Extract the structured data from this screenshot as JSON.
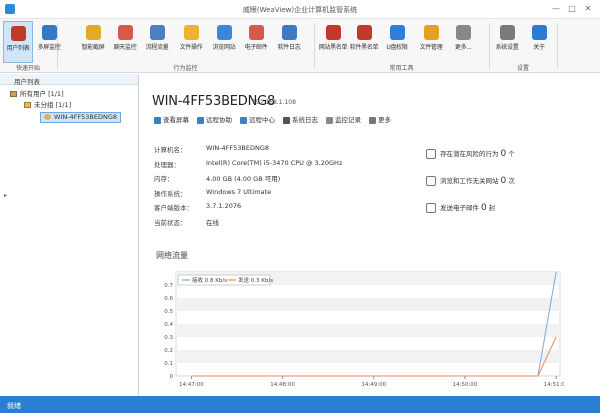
{
  "window": {
    "title": "威眼(WeaView)企业计算机监管系统",
    "min": "—",
    "max": "□",
    "close": "✕"
  },
  "ribbon": {
    "groups": [
      "快速开始",
      "行为监控",
      "常用工具",
      "设置"
    ],
    "buttons": [
      "用户列表",
      "多屏监控",
      "智能截屏",
      "聊天监控",
      "流程流量",
      "文件操作",
      "浏览网站",
      "电子邮件",
      "软件日志",
      "网站黑名单",
      "软件黑名单",
      "U盘权限",
      "文件管理",
      "更多...",
      "系统设置",
      "关于"
    ],
    "colors": [
      "#c0392b",
      "#3478c6",
      "#e0a92a",
      "#d65a4a",
      "#4a7fc1",
      "#f0b233",
      "#3a88d8",
      "#d55a4e",
      "#3e7bc4",
      "#c0392b",
      "#c0392b",
      "#2e7fd5",
      "#e8a024",
      "#888888",
      "#7a7a7a",
      "#2d7bd1"
    ]
  },
  "sidebar": {
    "header": "用户列表",
    "tree": [
      {
        "label": "所有用户 [1/1]"
      },
      {
        "label": "未分组 [1/1]"
      },
      {
        "label": "WIN-4FF53BEDNG8"
      }
    ]
  },
  "computer": {
    "hostname": "WIN-4FF53BEDNG8",
    "ip": "192.168.1.108",
    "actions": [
      "查看屏幕",
      "远程协助",
      "远程中心",
      "系统日志",
      "监控记录",
      "更多"
    ],
    "info": [
      {
        "key": "计算机名：",
        "value": "WIN-4FF53BEDNG8"
      },
      {
        "key": "处理器：",
        "value": "Intel(R) Core(TM) i5-3470 CPU @ 3.20GHz"
      },
      {
        "key": "内存：",
        "value": "4.00 GB (4.00 GB 可用)"
      },
      {
        "key": "操作系统：",
        "value": "Windows 7 Ultimate"
      },
      {
        "key": "客户端版本：",
        "value": "3.7.1.2076"
      },
      {
        "key": "当前状态：",
        "value": "在线"
      }
    ],
    "stats": [
      {
        "prefix": "存在潜在风险的行为",
        "count": "0",
        "suffix": "个",
        "icon": "lock-icon"
      },
      {
        "prefix": "浏览和工作无关网站",
        "count": "0",
        "suffix": "次",
        "icon": "compass-icon"
      },
      {
        "prefix": "发送电子邮件",
        "count": "0",
        "suffix": "封",
        "icon": "mail-icon"
      }
    ]
  },
  "network": {
    "title": "网络流量"
  },
  "chart_data": {
    "type": "line",
    "x": [
      "14:47:00",
      "14:48:00",
      "14:49:00",
      "14:50:00",
      "14:51:00"
    ],
    "y_ticks": [
      "0",
      "0.1",
      "0.2",
      "0.3",
      "0.4",
      "0.5",
      "0.6",
      "0.7"
    ],
    "ylim": [
      0,
      0.8
    ],
    "series": [
      {
        "name": "接收 0.8 Kb/s",
        "color": "#7fa8d8",
        "points": [
          [
            0,
            0
          ],
          [
            3.8,
            0
          ],
          [
            4.0,
            0.8
          ]
        ]
      },
      {
        "name": "发送 0.3 Kb/s",
        "color": "#f08a5a",
        "points": [
          [
            0,
            0
          ],
          [
            3.8,
            0
          ],
          [
            4.0,
            0.3
          ]
        ]
      }
    ]
  },
  "status": {
    "text": "就绪"
  }
}
